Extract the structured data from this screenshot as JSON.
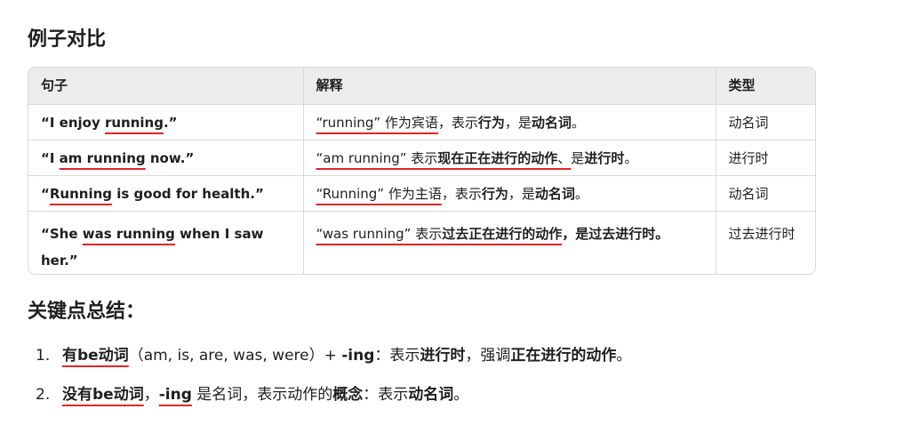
{
  "heading_examples": "例子对比",
  "heading_summary": "关键点总结：",
  "table": {
    "headers": [
      "句子",
      "解释",
      "类型"
    ],
    "rows": [
      {
        "sentence": [
          "“I enjoy ",
          "running",
          ".”"
        ],
        "explain": [
          "“running” 作为宾语",
          "，表示",
          "行为",
          "，是",
          "动名词",
          "。"
        ],
        "type": "动名词"
      },
      {
        "sentence": [
          "“I ",
          "am running",
          " now.”"
        ],
        "explain": [
          "“am running” 表示",
          "现在正在进行的动作",
          "、",
          "是",
          "进行时",
          "。"
        ],
        "type": "进行时"
      },
      {
        "sentence": [
          "“",
          "Running",
          " is good for health.”"
        ],
        "explain": [
          "“Running” 作为主语",
          "，表示",
          "行为",
          "，是",
          "动名词",
          "。"
        ],
        "type": "动名词"
      },
      {
        "sentence": [
          "“She ",
          "was running",
          " when I saw her.”"
        ],
        "explain": [
          "“was running” 表示",
          "过去正在进行的动作",
          "，是",
          "过去进行时",
          "。"
        ],
        "type": "过去进行时"
      }
    ]
  },
  "summary": [
    {
      "num": "1.",
      "parts": [
        "有be动词",
        "（am, is, are, was, were）+ ",
        "-ing",
        "：表示",
        "进行时",
        "，强调",
        "正在进行的动作",
        "。"
      ]
    },
    {
      "num": "2.",
      "parts": [
        "没有be动词",
        "，",
        "-ing",
        " 是名词，表示动作的",
        "概念",
        "：表示",
        "动名词",
        "。"
      ]
    }
  ],
  "colors": {
    "annotation": "#e0242a",
    "header_bg": "#ececec",
    "border": "#dadada"
  }
}
